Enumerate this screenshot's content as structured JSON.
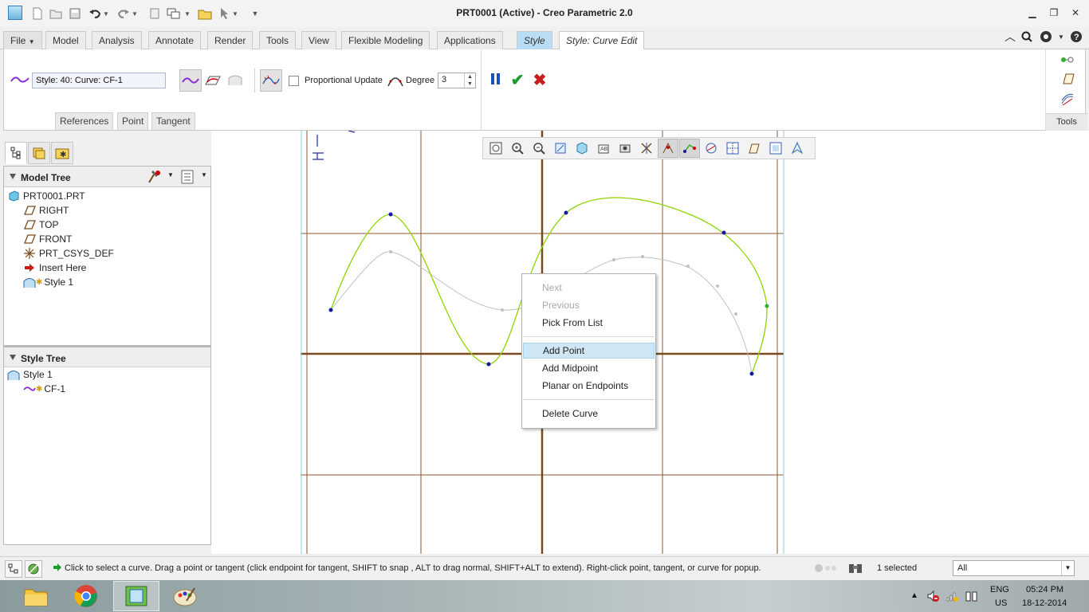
{
  "window": {
    "title": "PRT0001 (Active) - Creo Parametric 2.0"
  },
  "ribbon_tabs": [
    {
      "label": "File"
    },
    {
      "label": "Model"
    },
    {
      "label": "Analysis"
    },
    {
      "label": "Annotate"
    },
    {
      "label": "Render"
    },
    {
      "label": "Tools"
    },
    {
      "label": "View"
    },
    {
      "label": "Flexible Modeling"
    },
    {
      "label": "Applications"
    },
    {
      "label": "Style"
    },
    {
      "label": "Style: Curve Edit"
    }
  ],
  "ribbon": {
    "curve_field": "Style: 40: Curve:   CF-1",
    "proportional_update_label": "Proportional Update",
    "proportional_update_checked": false,
    "degree_label": "Degree",
    "degree_value": "3",
    "subtabs": [
      "References",
      "Point",
      "Tangent"
    ],
    "tools_label": "Tools"
  },
  "model_tree": {
    "title": "Model Tree",
    "items": [
      {
        "label": "PRT0001.PRT",
        "icon": "part-icon"
      },
      {
        "label": "RIGHT",
        "icon": "datum-plane-icon"
      },
      {
        "label": "TOP",
        "icon": "datum-plane-icon"
      },
      {
        "label": "FRONT",
        "icon": "datum-plane-icon"
      },
      {
        "label": "PRT_CSYS_DEF",
        "icon": "csys-icon"
      },
      {
        "label": "Insert Here",
        "icon": "insert-arrow-icon"
      },
      {
        "label": "Style 1",
        "icon": "style-feature-icon"
      }
    ]
  },
  "style_tree": {
    "title": "Style Tree",
    "items": [
      {
        "label": "Style 1",
        "icon": "style-feature-icon"
      },
      {
        "label": "CF-1",
        "icon": "curve-icon"
      }
    ]
  },
  "context_menu": {
    "items": [
      {
        "label": "Next",
        "enabled": false
      },
      {
        "label": "Previous",
        "enabled": false
      },
      {
        "label": "Pick From List",
        "enabled": true
      },
      {
        "label": "Add Point",
        "enabled": true,
        "highlighted": true
      },
      {
        "label": "Add Midpoint",
        "enabled": true
      },
      {
        "label": "Planar on Endpoints",
        "enabled": true
      },
      {
        "label": "Delete Curve",
        "enabled": true
      }
    ]
  },
  "status": {
    "message": "Click to select a curve.  Drag a point or tangent (click endpoint for tangent, SHIFT to snap , ALT to drag normal, SHIFT+ALT to extend). Right-click point, tangent, or curve for popup.",
    "selected": "1 selected",
    "filter": "All"
  },
  "taskbar": {
    "language": "ENG",
    "region": "US",
    "time": "05:24 PM",
    "date": "18-12-2014"
  },
  "colors": {
    "curve": "#8fd400",
    "curve_ghost": "#c0c0c0",
    "control_point": "#1515a8",
    "datum_plane": "#7a4a1e",
    "ribbon_style_tab": "#b8ddf4",
    "menu_highlight": "#cfe6f4"
  }
}
